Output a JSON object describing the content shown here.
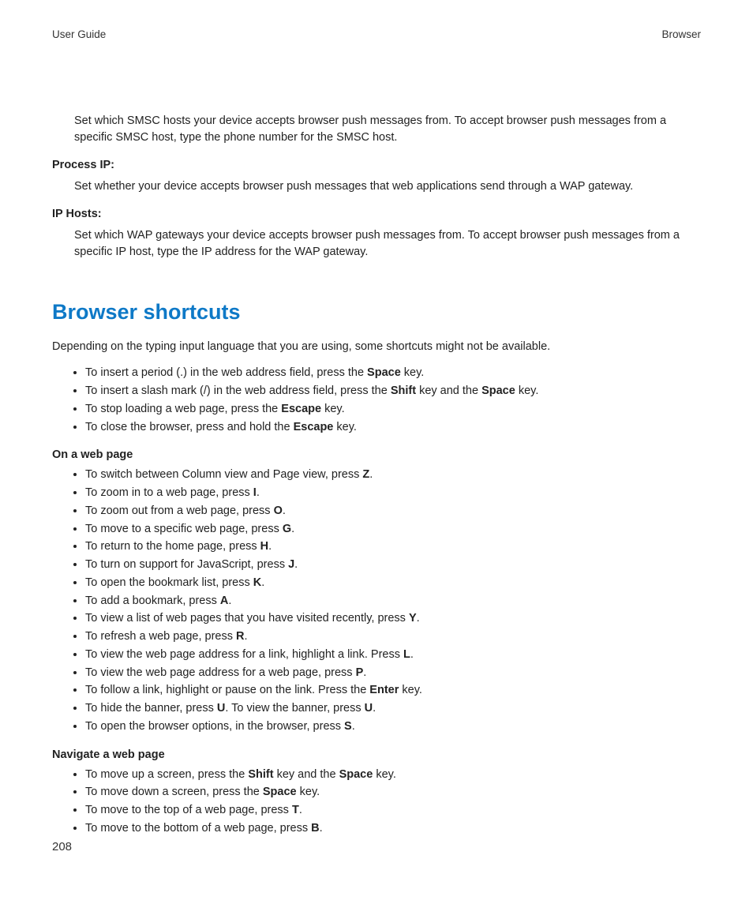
{
  "header": {
    "left": "User Guide",
    "right": "Browser"
  },
  "intro_para": "Set which SMSC hosts your device accepts browser push messages from. To accept browser push messages from a specific SMSC host, type the phone number for the SMSC host.",
  "def1": {
    "term": "Process IP",
    "desc": "Set whether your device accepts browser push messages that web applications send through a WAP gateway."
  },
  "def2": {
    "term": "IP Hosts",
    "desc": "Set which WAP gateways your device accepts browser push messages from. To accept browser push messages from a specific IP host, type the IP address for the WAP gateway."
  },
  "section_title": "Browser shortcuts",
  "section_lead": "Depending on the typing input language that you are using, some shortcuts might not be available.",
  "list1": [
    {
      "pre": "To insert a period (.) in the web address field, press the ",
      "k": "Space",
      "post": " key."
    },
    {
      "pre": "To insert a slash mark (/) in the web address field, press the ",
      "k": "Shift",
      "mid": " key and the ",
      "k2": "Space",
      "post": " key."
    },
    {
      "pre": "To stop loading a web page, press the ",
      "k": "Escape",
      "post": " key."
    },
    {
      "pre": "To close the browser, press and hold the ",
      "k": "Escape",
      "post": " key."
    }
  ],
  "subhead1": "On a web page",
  "list2": [
    {
      "pre": "To switch between Column view and Page view, press ",
      "k": "Z",
      "post": "."
    },
    {
      "pre": "To zoom in to a web page, press ",
      "k": "I",
      "post": "."
    },
    {
      "pre": "To zoom out from a web page, press ",
      "k": "O",
      "post": "."
    },
    {
      "pre": "To move to a specific web page, press ",
      "k": "G",
      "post": "."
    },
    {
      "pre": "To return to the home page, press ",
      "k": "H",
      "post": "."
    },
    {
      "pre": "To turn on support for JavaScript, press ",
      "k": "J",
      "post": "."
    },
    {
      "pre": "To open the bookmark list, press ",
      "k": "K",
      "post": "."
    },
    {
      "pre": "To add a bookmark, press ",
      "k": "A",
      "post": "."
    },
    {
      "pre": "To view a list of web pages that you have visited recently, press ",
      "k": "Y",
      "post": "."
    },
    {
      "pre": "To refresh a web page, press ",
      "k": "R",
      "post": "."
    },
    {
      "pre": "To view the web page address for a link, highlight a link. Press ",
      "k": "L",
      "post": "."
    },
    {
      "pre": "To view the web page address for a web page, press ",
      "k": "P",
      "post": "."
    },
    {
      "pre": "To follow a link, highlight or pause on the link. Press the ",
      "k": "Enter",
      "post": " key."
    },
    {
      "pre": "To hide the banner, press ",
      "k": "U",
      "mid": ". To view the banner, press ",
      "k2": "U",
      "post": "."
    },
    {
      "pre": "To open the browser options, in the browser, press ",
      "k": "S",
      "post": "."
    }
  ],
  "subhead2": "Navigate a web page",
  "list3": [
    {
      "pre": "To move up a screen, press the ",
      "k": "Shift",
      "mid": " key and the ",
      "k2": "Space",
      "post": " key."
    },
    {
      "pre": "To move down a screen, press the ",
      "k": "Space",
      "post": " key."
    },
    {
      "pre": "To move to the top of a web page, press ",
      "k": "T",
      "post": "."
    },
    {
      "pre": "To move to the bottom of a web page, press ",
      "k": "B",
      "post": "."
    }
  ],
  "page_number": "208"
}
